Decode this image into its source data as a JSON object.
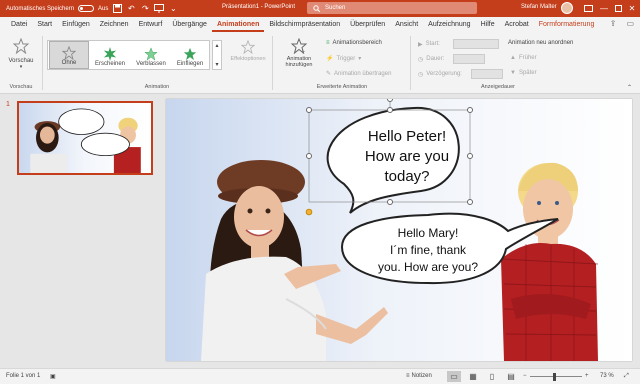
{
  "titlebar": {
    "autosave_label": "Automatisches Speichern",
    "autosave_state": "Aus",
    "document_title": "Präsentation1 - PowerPoint",
    "search_placeholder": "Suchen",
    "user_name": "Stefan Malter"
  },
  "tabs": [
    "Datei",
    "Start",
    "Einfügen",
    "Zeichnen",
    "Entwurf",
    "Übergänge",
    "Animationen",
    "Bildschirmpräsentation",
    "Überprüfen",
    "Ansicht",
    "Aufzeichnung",
    "Hilfe",
    "Acrobat",
    "Formformatierung"
  ],
  "active_tab": "Animationen",
  "ribbon": {
    "preview": {
      "label": "Vorschau",
      "group": "Vorschau"
    },
    "gallery": [
      "Ohne",
      "Erscheinen",
      "Verblassen",
      "Einfliegen"
    ],
    "effect_options": "Effektoptionen",
    "animation_group": "Animation",
    "add_animation": "Animation hinzufügen",
    "animation_pane": "Animationsbereich",
    "trigger": "Trigger",
    "animation_painter": "Animation übertragen",
    "advanced_group": "Erweiterte Animation",
    "start_label": "Start:",
    "duration_label": "Dauer:",
    "delay_label": "Verzögerung:",
    "reorder_label": "Animation neu anordnen",
    "earlier": "Früher",
    "later": "Später",
    "timing_group": "Anzeigedauer"
  },
  "slide": {
    "number": "1",
    "bubble1": [
      "Hello Peter!",
      "How are you",
      "today?"
    ],
    "bubble2": [
      "Hello Mary!",
      "I´m fine, thank",
      "you. How are you?"
    ]
  },
  "statusbar": {
    "slide_info": "Folie 1 von 1",
    "notes": "Notizen",
    "zoom": "73 %"
  },
  "colors": {
    "accent": "#c43e1c",
    "ribbon_bg": "#f3f3f3",
    "star_green": "#3aa55a"
  }
}
